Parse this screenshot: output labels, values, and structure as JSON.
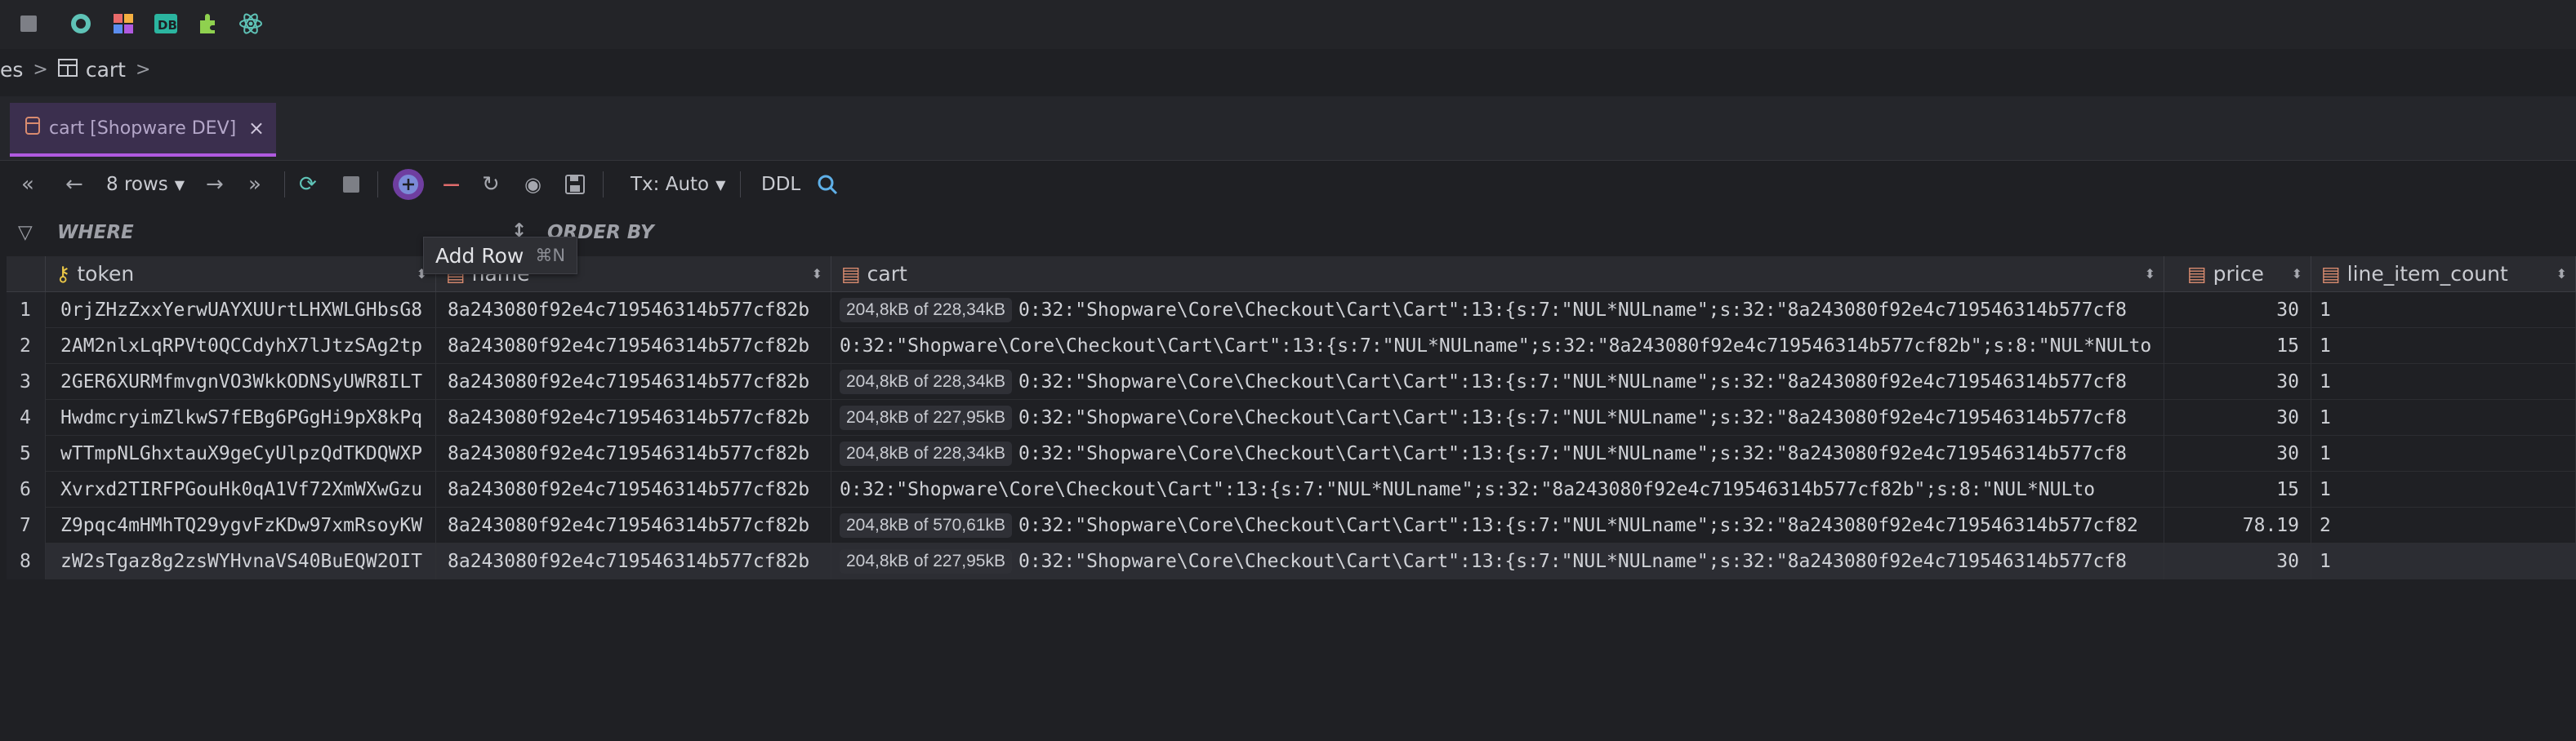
{
  "toolbar_icons": [
    "stop-icon",
    "circle-logo-icon",
    "blocks-icon",
    "db-icon",
    "plugin-icon",
    "atom-icon"
  ],
  "breadcrumb": {
    "prefix": "es",
    "table": "cart"
  },
  "tab": {
    "label": "cart [Shopware DEV]",
    "close": "×"
  },
  "data_toolbar": {
    "rows_label": "8 rows",
    "tx_label": "Tx: Auto",
    "ddl_label": "DDL"
  },
  "filter": {
    "where": "WHERE",
    "order_by": "ORDER BY"
  },
  "tooltip": {
    "label": "Add Row",
    "shortcut": "⌘N"
  },
  "columns": [
    "token",
    "name",
    "cart",
    "price",
    "line_item_count"
  ],
  "rows": [
    {
      "n": "1",
      "token": "0rjZHzZxxYerwUAYXUUrtLHXWLGHbsG8",
      "name": "8a243080f92e4c719546314b577cf82b",
      "size": "204,8kB of 228,34kB",
      "cart": "0:32:\"Shopware\\Core\\Checkout\\Cart\\Cart\":13:{s:7:\"NUL*NULname\";s:32:\"8a243080f92e4c719546314b577cf8",
      "price": "30",
      "count": "1"
    },
    {
      "n": "2",
      "token": "2AM2nlxLqRPVt0QCCdyhX7lJtzSAg2tp",
      "name": "8a243080f92e4c719546314b577cf82b",
      "size": "",
      "cart": "0:32:\"Shopware\\Core\\Checkout\\Cart\\Cart\":13:{s:7:\"NUL*NULname\";s:32:\"8a243080f92e4c719546314b577cf82b\";s:8:\"NUL*NULto",
      "price": "15",
      "count": "1"
    },
    {
      "n": "3",
      "token": "2GER6XURMfmvgnVO3WkkODNSyUWR8ILT",
      "name": "8a243080f92e4c719546314b577cf82b",
      "size": "204,8kB of 228,34kB",
      "cart": "0:32:\"Shopware\\Core\\Checkout\\Cart\\Cart\":13:{s:7:\"NUL*NULname\";s:32:\"8a243080f92e4c719546314b577cf8",
      "price": "30",
      "count": "1"
    },
    {
      "n": "4",
      "token": "HwdmcryimZlkwS7fEBg6PGgHi9pX8kPq",
      "name": "8a243080f92e4c719546314b577cf82b",
      "size": "204,8kB of 227,95kB",
      "cart": "0:32:\"Shopware\\Core\\Checkout\\Cart\\Cart\":13:{s:7:\"NUL*NULname\";s:32:\"8a243080f92e4c719546314b577cf8",
      "price": "30",
      "count": "1"
    },
    {
      "n": "5",
      "token": "wTTmpNLGhxtauX9geCyUlpzQdTKDQWXP",
      "name": "8a243080f92e4c719546314b577cf82b",
      "size": "204,8kB of 228,34kB",
      "cart": "0:32:\"Shopware\\Core\\Checkout\\Cart\\Cart\":13:{s:7:\"NUL*NULname\";s:32:\"8a243080f92e4c719546314b577cf8",
      "price": "30",
      "count": "1"
    },
    {
      "n": "6",
      "token": "Xvrxd2TIRFPGouHk0qA1Vf72XmWXwGzu",
      "name": "8a243080f92e4c719546314b577cf82b",
      "size": "",
      "cart": "0:32:\"Shopware\\Core\\Checkout\\Cart\":13:{s:7:\"NUL*NULname\";s:32:\"8a243080f92e4c719546314b577cf82b\";s:8:\"NUL*NULto",
      "price": "15",
      "count": "1"
    },
    {
      "n": "7",
      "token": "Z9pqc4mHMhTQ29ygvFzKDw97xmRsoyKW",
      "name": "8a243080f92e4c719546314b577cf82b",
      "size": "204,8kB of 570,61kB",
      "cart": "0:32:\"Shopware\\Core\\Checkout\\Cart\\Cart\":13:{s:7:\"NUL*NULname\";s:32:\"8a243080f92e4c719546314b577cf82",
      "price": "78.19",
      "count": "2"
    },
    {
      "n": "8",
      "token": "zW2sTgaz8g2zsWYHvnaVS40BuEQW2OIT",
      "name": "8a243080f92e4c719546314b577cf82b",
      "size": "204,8kB of 227,95kB",
      "cart": "0:32:\"Shopware\\Core\\Checkout\\Cart\\Cart\":13:{s:7:\"NUL*NULname\";s:32:\"8a243080f92e4c719546314b577cf8",
      "price": "30",
      "count": "1"
    }
  ]
}
